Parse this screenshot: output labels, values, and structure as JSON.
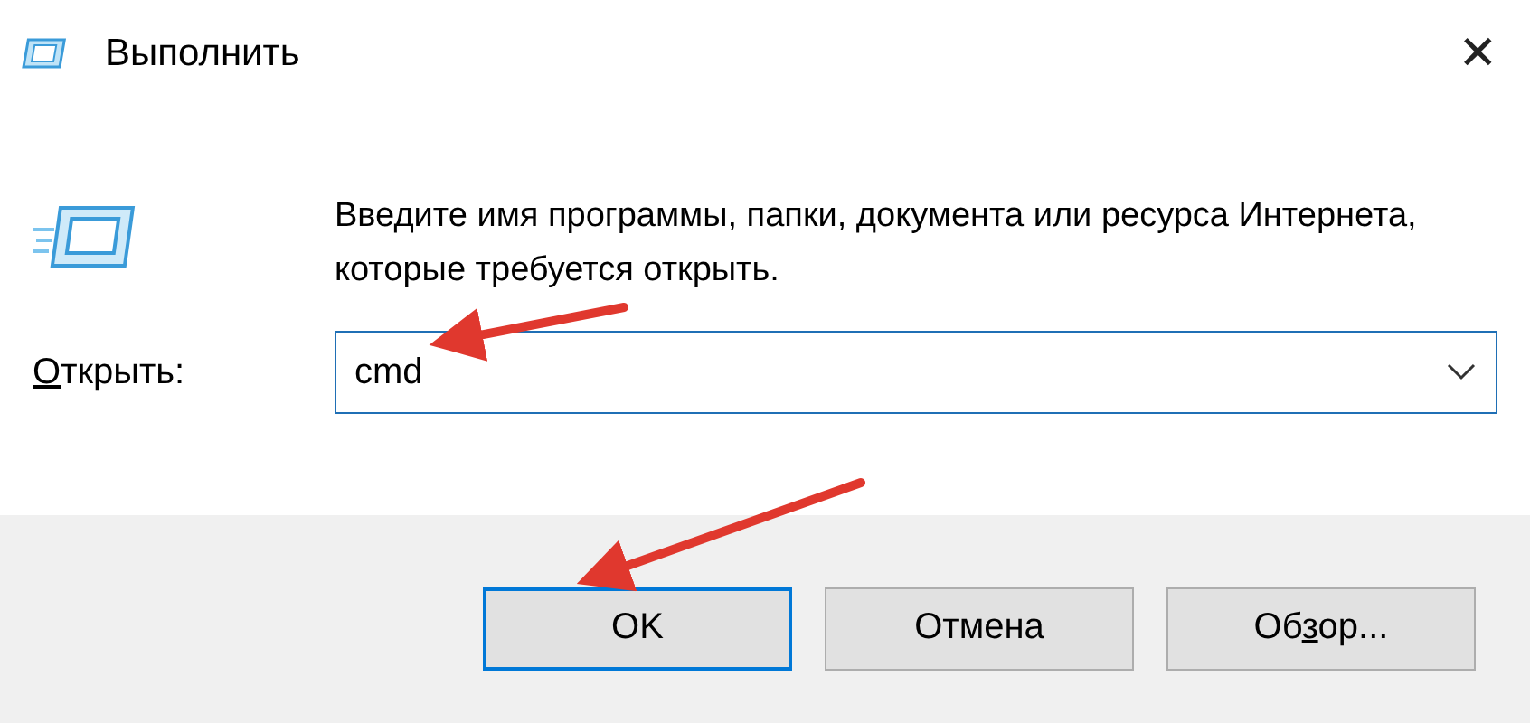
{
  "window": {
    "title": "Выполнить",
    "close": "✕"
  },
  "prompt": "Введите имя программы, папки, документа или ресурса Интернета, которые требуется открыть.",
  "open_field": {
    "label": {
      "key": "О",
      "after": "ткрыть:"
    },
    "value": "cmd"
  },
  "buttons": [
    {
      "label": {
        "after": "OK"
      },
      "default": true
    },
    {
      "label": {
        "after": "Отмена"
      },
      "default": false
    },
    {
      "label": {
        "before": "Об",
        "key": "з",
        "after": "ор..."
      },
      "default": false
    }
  ],
  "annotations": [
    {
      "kind": "arrow"
    },
    {
      "kind": "arrow"
    }
  ]
}
